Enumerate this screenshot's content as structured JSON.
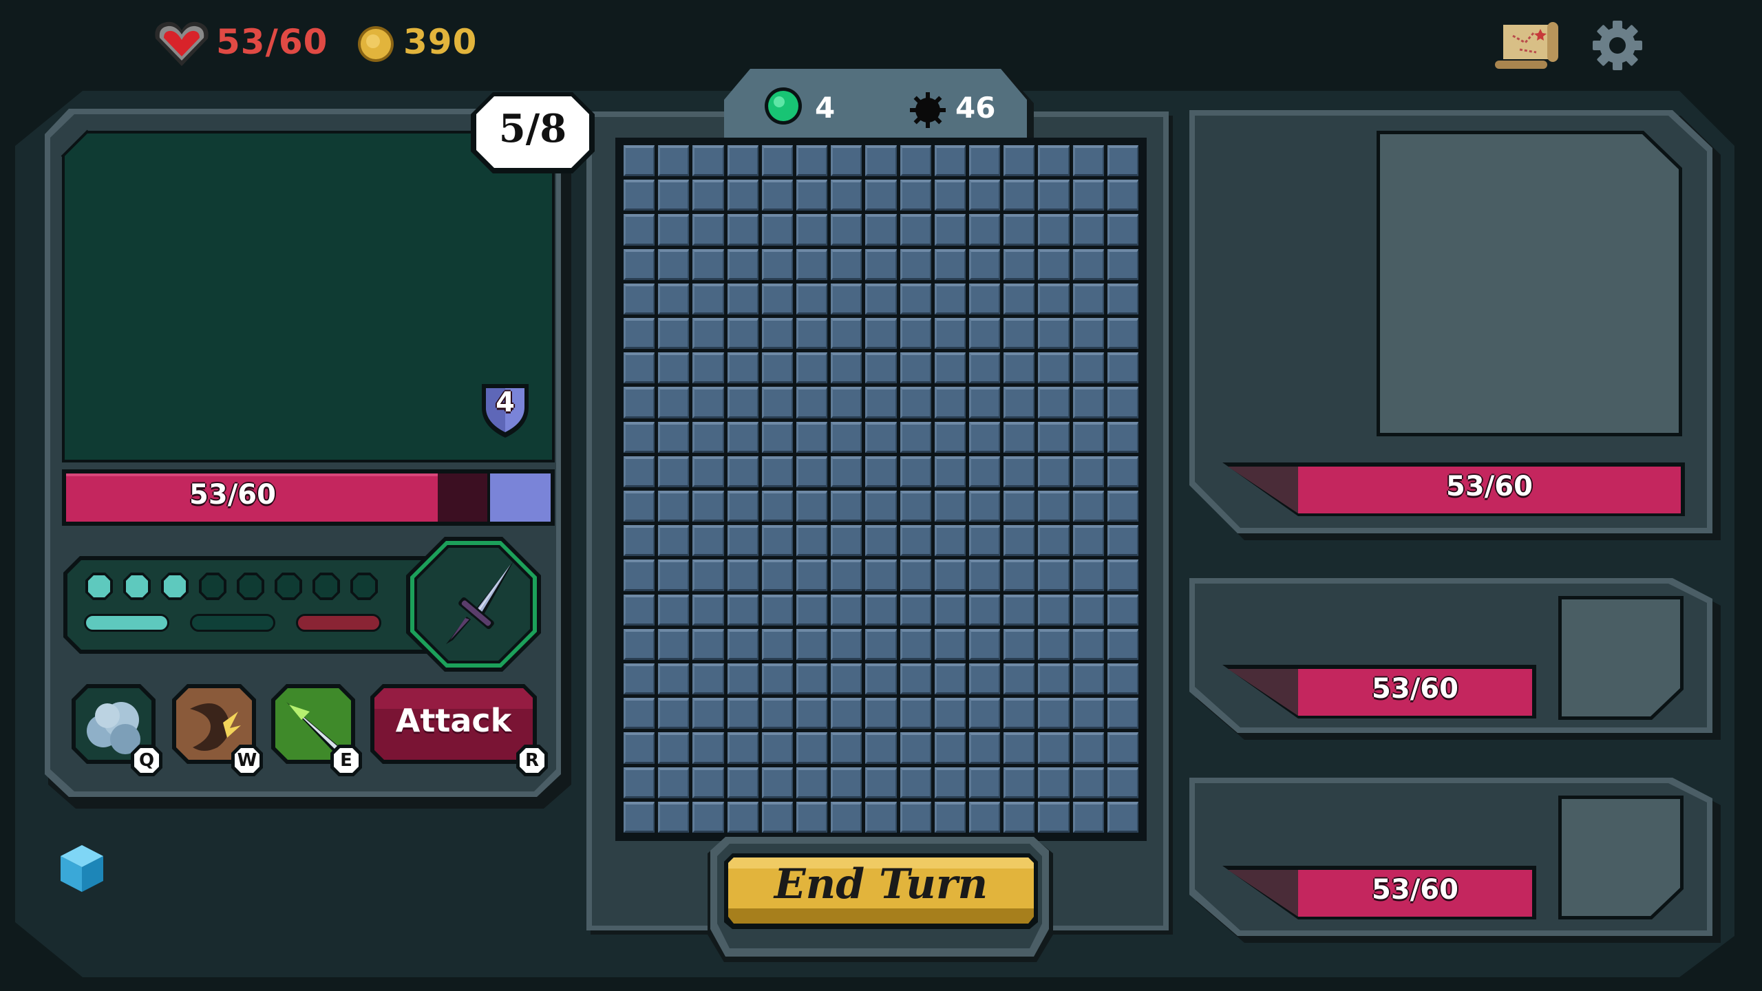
{
  "top_bar": {
    "health": "53/60",
    "gold": "390",
    "icons": {
      "health": "heart-icon",
      "gold": "coin-icon",
      "map": "map-scroll-icon",
      "settings": "gear-icon"
    }
  },
  "player": {
    "turn_counter": "5/8",
    "shield": "4",
    "health_bar": {
      "label": "53/60",
      "fraction": 0.883
    },
    "energy": {
      "filled": 3,
      "total": 8
    },
    "weapon_icon": "dagger-icon",
    "skills": [
      {
        "name": "cloud-skill",
        "key": "Q"
      },
      {
        "name": "claw-skill",
        "key": "W"
      },
      {
        "name": "spear-skill",
        "key": "E"
      }
    ],
    "attack": {
      "label": "Attack",
      "key": "R"
    }
  },
  "board": {
    "green_count": "4",
    "bomb_count": "46",
    "columns": 15,
    "rows": 20,
    "end_turn_label": "End Turn"
  },
  "enemies": [
    {
      "health_label": "53/60"
    },
    {
      "health_label": "53/60"
    },
    {
      "health_label": "53/60"
    }
  ],
  "colors": {
    "background": "#0f1a1c",
    "panel": "#2e4046",
    "health": "#c4265e",
    "energy": "#5ec9be",
    "gold": "#e2b43c",
    "board_cell": "#4a6784"
  }
}
